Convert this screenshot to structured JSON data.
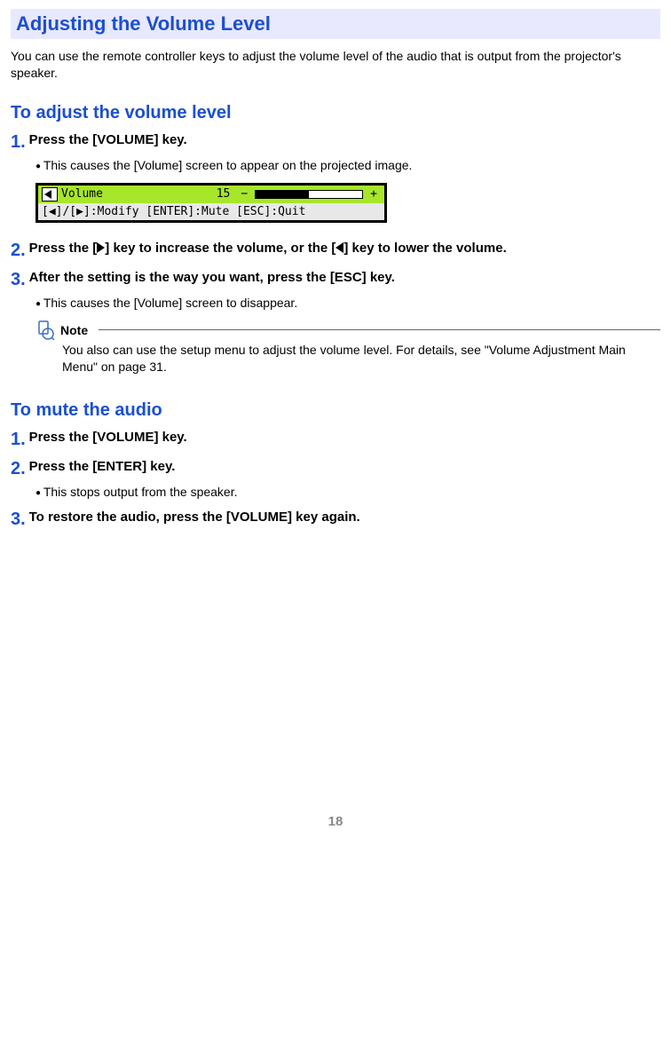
{
  "banner_title": "Adjusting the Volume Level",
  "intro": "You can use the remote controller keys to adjust the volume level of the audio that is output from the projector's speaker.",
  "section1_title": "To adjust the volume level",
  "s1_step1_num": "1.",
  "s1_step1_text": "Press the [VOLUME] key.",
  "s1_step1_bullet": "This causes the [Volume] screen to appear on the projected image.",
  "osd": {
    "label": "Volume",
    "value": "15",
    "minus": "−",
    "plus": "+",
    "hint": "[◀]/[▶]:Modify [ENTER]:Mute [ESC]:Quit"
  },
  "s1_step2_num": "2.",
  "s1_step2_pre": "Press the [",
  "s1_step2_mid": "] key to increase the volume, or the [",
  "s1_step2_post": "] key to lower the volume.",
  "s1_step3_num": "3.",
  "s1_step3_text": "After the setting is the way you want, press the [ESC] key.",
  "s1_step3_bullet": "This causes the [Volume] screen to disappear.",
  "note_label": "Note",
  "note_body": "You also can use the setup menu to adjust the volume level. For details, see \"Volume Adjustment Main Menu\" on page 31.",
  "section2_title": "To mute the audio",
  "s2_step1_num": "1.",
  "s2_step1_text": "Press the [VOLUME] key.",
  "s2_step2_num": "2.",
  "s2_step2_text": "Press the [ENTER] key.",
  "s2_step2_bullet": "This stops output from the speaker.",
  "s2_step3_num": "3.",
  "s2_step3_text": "To restore the audio, press the [VOLUME] key again.",
  "page_number": "18"
}
